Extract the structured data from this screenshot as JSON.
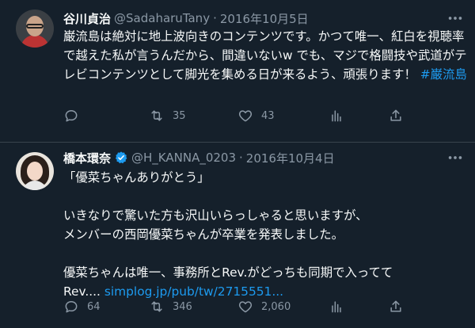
{
  "tweets": [
    {
      "name": "谷川貞治",
      "handle": "@SadaharuTany",
      "date": "2016年10月5日",
      "text": "巌流島は絶対に地上波向きのコンテンツです。かつて唯一、紅白を視聴率で越えた私が言うんだから、間違いないw でも、マジで格闘技や武道がテレビコンテンツとして脚光を集める日が来るよう、頑張ります！ ",
      "hashtag": "#巌流島",
      "reply_count": "",
      "retweet_count": "35",
      "like_count": "43"
    },
    {
      "name": "橋本環奈",
      "handle": "@H_KANNA_0203",
      "date": "2016年10月4日",
      "text": "「優菜ちゃんありがとう」\n\nいきなりで驚いた方も沢山いらっしゃると思いますが、\nメンバーの西岡優菜ちゃんが卒業を発表しました。\n\n優菜ちゃんは唯一、事務所とRev.がどっちも同期で入ってて\nRev.... ",
      "link": "simplog.jp/pub/tw/2715551...",
      "reply_count": "64",
      "retweet_count": "346",
      "like_count": "2,060"
    }
  ],
  "colors": {
    "background": "#15202b",
    "text": "#f7f9f9",
    "muted": "#8b98a5",
    "accent": "#1d9bf0",
    "border": "#38444d"
  },
  "icons": [
    "more-icon",
    "verified-badge-icon",
    "reply-icon",
    "retweet-icon",
    "like-icon",
    "analytics-icon",
    "share-icon"
  ]
}
